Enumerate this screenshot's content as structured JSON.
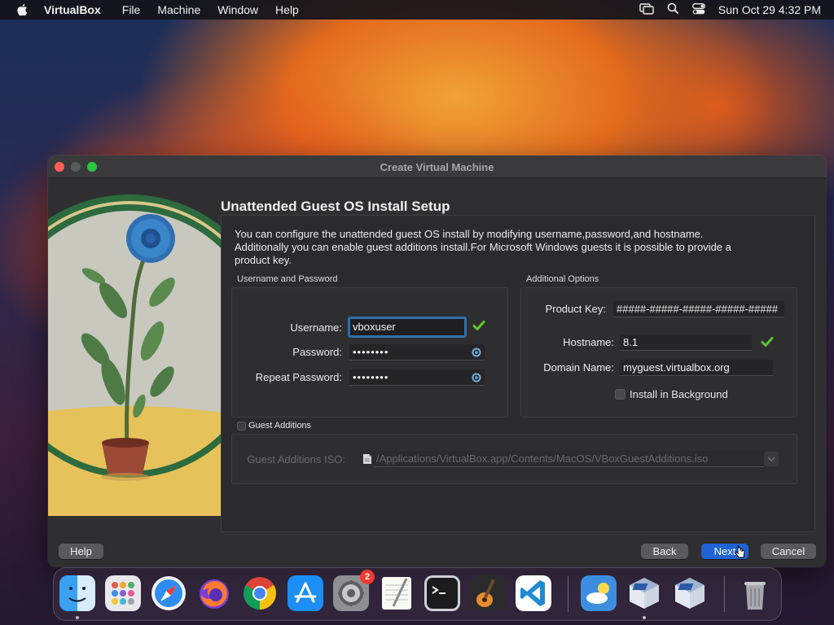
{
  "menubar": {
    "app_name": "VirtualBox",
    "items": [
      "File",
      "Machine",
      "Window",
      "Help"
    ],
    "clock": "Sun Oct 29  4:32 PM"
  },
  "window": {
    "title": "Create Virtual Machine",
    "heading": "Unattended Guest OS Install Setup",
    "description": "You can configure the unattended guest OS install by modifying username,password,and hostname. Additionally you can enable guest additions install.For Microsoft Windows guests it is possible to provide a product key.",
    "username_group": {
      "label": "Username and Password",
      "username_label": "Username:",
      "username_value": "vboxuser",
      "password_label": "Password:",
      "password_value": "••••••••",
      "repeat_label": "Repeat Password:",
      "repeat_value": "••••••••"
    },
    "options_group": {
      "label": "Additional Options",
      "product_key_label": "Product Key:",
      "product_key_value": "#####-#####-#####-#####-#####",
      "hostname_label": "Hostname:",
      "hostname_value": "8.1",
      "domain_label": "Domain Name:",
      "domain_value": "myguest.virtualbox.org",
      "install_bg_label": "Install in Background",
      "install_bg_checked": false
    },
    "guest_additions": {
      "label": "Guest Additions",
      "checked": false,
      "iso_label": "Guest Additions ISO:",
      "iso_path": "/Applications/VirtualBox.app/Contents/MacOS/VBoxGuestAdditions.iso"
    },
    "buttons": {
      "help": "Help",
      "back": "Back",
      "next": "Next",
      "cancel": "Cancel"
    }
  },
  "dock": {
    "apps": [
      "Finder",
      "Launchpad",
      "Safari",
      "Firefox",
      "Chrome",
      "App Store",
      "System Settings",
      "TextEdit",
      "Terminal",
      "GarageBand",
      "Visual Studio Code",
      "Weather",
      "VirtualBox",
      "VirtualBox VM",
      "Trash"
    ],
    "settings_badge": "2"
  },
  "colors": {
    "accent": "#1f63d4",
    "focus_ring": "#2f6fa8",
    "valid_check": "#5fc832"
  }
}
